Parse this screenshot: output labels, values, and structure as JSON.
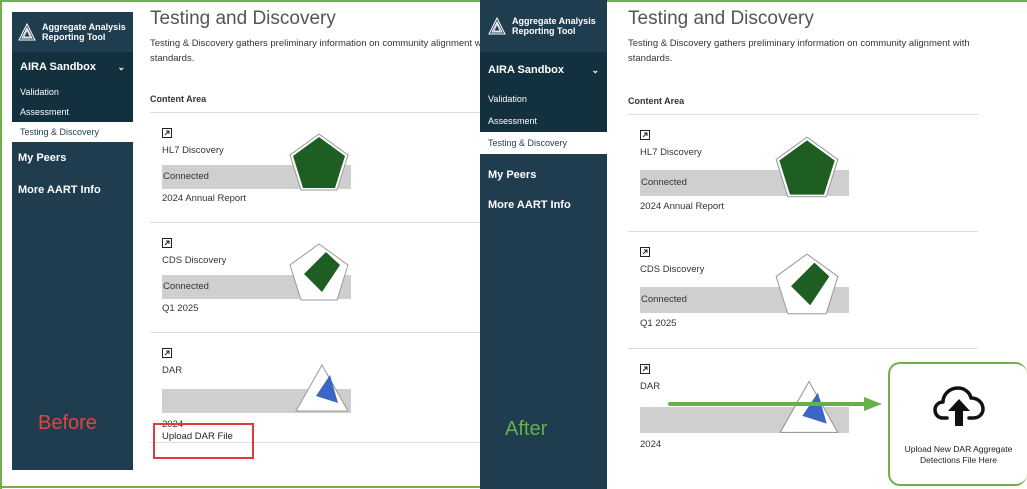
{
  "brand": {
    "line1": "Aggregate Analysis",
    "line2": "Reporting Tool"
  },
  "nav": {
    "group": "AIRA Sandbox",
    "sub": [
      "Validation",
      "Assessment",
      "Testing & Discovery"
    ],
    "peers": "My Peers",
    "info": "More AART Info"
  },
  "page": {
    "title": "Testing and Discovery",
    "intro_line1": "Testing & Discovery gathers preliminary information on community alignment with",
    "intro_line2": "standards.",
    "column_header": "Content Area"
  },
  "rows": [
    {
      "name": "HL7 Discovery",
      "status": "Connected",
      "period": "2024 Annual Report"
    },
    {
      "name": "CDS Discovery",
      "status": "Connected",
      "period": "Q1 2025"
    },
    {
      "name": "DAR",
      "status": "",
      "period": "2024",
      "link": "Upload DAR File"
    }
  ],
  "annotations": {
    "before": "Before",
    "after": "After"
  },
  "upload_card": {
    "line1": "Upload New DAR Aggregate",
    "line2": "Detections File Here"
  },
  "colors": {
    "sidebar": "#1f3d4f",
    "accent_green": "#6fb04a",
    "before_red": "#e2453c",
    "spark_green": "#1f5e22",
    "spark_blue": "#3a66c4"
  }
}
